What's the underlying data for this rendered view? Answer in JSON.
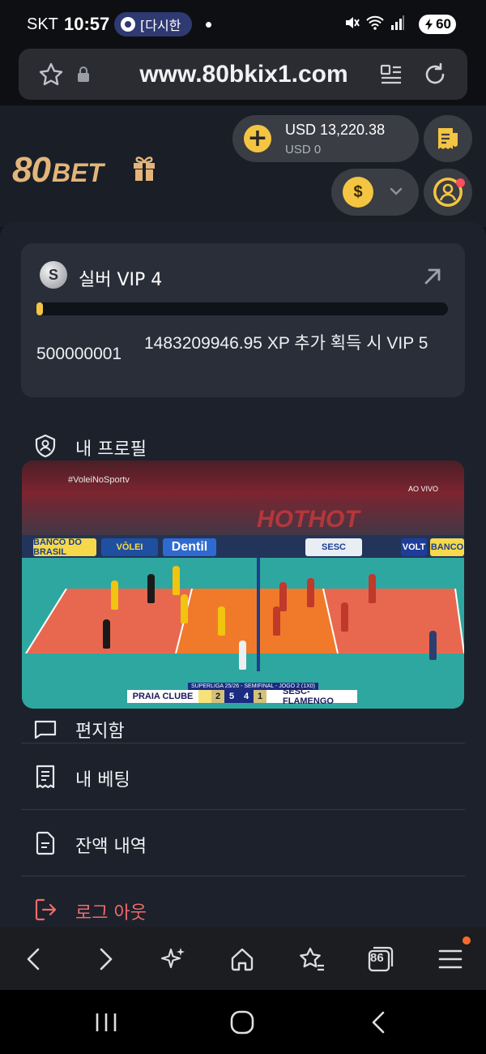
{
  "status_bar": {
    "carrier": "SKT",
    "time": "10:57",
    "pill_label": "[다시한",
    "battery": "60"
  },
  "browser": {
    "url": "www.80bkix1.com",
    "tab_count": "86"
  },
  "header": {
    "logo_big": "80",
    "logo_small": "BET",
    "balance_main": "USD 13,220.38",
    "balance_sub": "USD 0",
    "currency_symbol": "$",
    "accent_color": "#f4c542"
  },
  "vip": {
    "badge": "S",
    "title": "실버 VIP 4",
    "progress_fraction": 0.01,
    "current_xp": "500000001",
    "next_level_text": "1483209946.95 XP 추가 획득 시 VIP 5"
  },
  "menu": {
    "profile": "내 프로필",
    "inbox": "편지함",
    "my_bets": "내 베팅",
    "balance_history": "잔액 내역",
    "logout": "로그 아웃"
  },
  "video": {
    "hashtag": "#VoleiNoSportv",
    "live_label": "AO VIVO",
    "watermark": "HOTHOT",
    "league": "SUPERLIGA 25/26 - SEMIFINAL - JOGO 2 (1X0)",
    "team_home": "PRAIA CLUBE",
    "team_away": "SESC-FLAMENGO",
    "sets_home": "2",
    "points_home": "5",
    "points_away": "4",
    "sets_away": "1",
    "ads": [
      "BANCO DO BRASIL",
      "VÔLEI",
      "Dentil",
      "SESC",
      "VOLT",
      "BANCO"
    ]
  }
}
